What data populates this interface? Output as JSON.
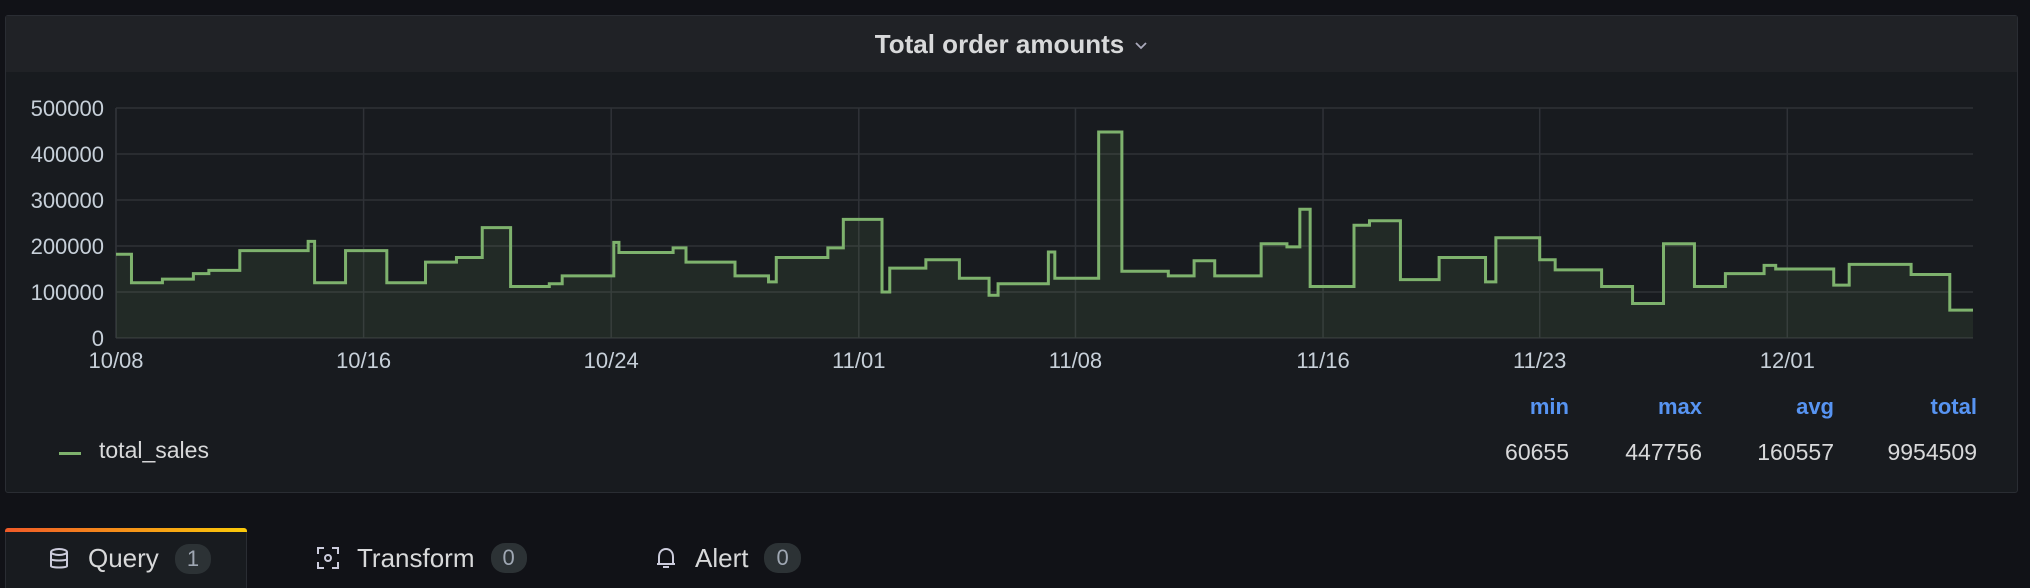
{
  "panel": {
    "title": "Total order amounts"
  },
  "chart_data": {
    "type": "area",
    "interpolation": "step-before",
    "series_color": "#7eb26d",
    "ylim": [
      0,
      500000
    ],
    "y_ticks": [
      "500000",
      "400000",
      "300000",
      "200000",
      "100000",
      "0"
    ],
    "x_ticks": [
      "10/08",
      "10/16",
      "10/24",
      "11/01",
      "11/08",
      "11/16",
      "11/23",
      "12/01"
    ],
    "x_range": [
      "2022-10-08",
      "2022-12-07"
    ],
    "grid": true,
    "series": [
      {
        "name": "total_sales",
        "points": [
          [
            "2022-10-08",
            182000
          ],
          [
            "2022-10-08T12",
            120000
          ],
          [
            "2022-10-09",
            120000
          ],
          [
            "2022-10-09T12",
            128000
          ],
          [
            "2022-10-10",
            128000
          ],
          [
            "2022-10-10T12",
            140000
          ],
          [
            "2022-10-11",
            147000
          ],
          [
            "2022-10-12",
            190000
          ],
          [
            "2022-10-13",
            190000
          ],
          [
            "2022-10-14",
            190000
          ],
          [
            "2022-10-14T05",
            210000
          ],
          [
            "2022-10-14T10",
            120000
          ],
          [
            "2022-10-15",
            120000
          ],
          [
            "2022-10-15T10",
            190000
          ],
          [
            "2022-10-16",
            190000
          ],
          [
            "2022-10-16T18",
            120000
          ],
          [
            "2022-10-17",
            120000
          ],
          [
            "2022-10-18",
            165000
          ],
          [
            "2022-10-19",
            175000
          ],
          [
            "2022-10-19T20",
            240000
          ],
          [
            "2022-10-20",
            240000
          ],
          [
            "2022-10-20T18",
            112000
          ],
          [
            "2022-10-21",
            112000
          ],
          [
            "2022-10-22",
            118000
          ],
          [
            "2022-10-22T10",
            135000
          ],
          [
            "2022-10-23",
            135000
          ],
          [
            "2022-10-24",
            135000
          ],
          [
            "2022-10-24T02",
            208000
          ],
          [
            "2022-10-24T06",
            186000
          ],
          [
            "2022-10-25",
            186000
          ],
          [
            "2022-10-26",
            196000
          ],
          [
            "2022-10-26T10",
            165000
          ],
          [
            "2022-10-27",
            165000
          ],
          [
            "2022-10-28",
            135000
          ],
          [
            "2022-10-29",
            135000
          ],
          [
            "2022-10-29T02",
            122000
          ],
          [
            "2022-10-29T08",
            175000
          ],
          [
            "2022-10-30",
            175000
          ],
          [
            "2022-10-31",
            196000
          ],
          [
            "2022-10-31T12",
            258000
          ],
          [
            "2022-11-01",
            258000
          ],
          [
            "2022-11-01T18",
            100000
          ],
          [
            "2022-11-02",
            152000
          ],
          [
            "2022-11-03",
            152000
          ],
          [
            "2022-11-03T04",
            170000
          ],
          [
            "2022-11-04",
            170000
          ],
          [
            "2022-11-04T06",
            130000
          ],
          [
            "2022-11-05",
            130000
          ],
          [
            "2022-11-05T05",
            93000
          ],
          [
            "2022-11-05T12",
            118000
          ],
          [
            "2022-11-06",
            118000
          ],
          [
            "2022-11-07",
            118000
          ],
          [
            "2022-11-07T03",
            187000
          ],
          [
            "2022-11-07T08",
            130000
          ],
          [
            "2022-11-08",
            130000
          ],
          [
            "2022-11-08T18",
            447756
          ],
          [
            "2022-11-09",
            447756
          ],
          [
            "2022-11-09T12",
            145000
          ],
          [
            "2022-11-10",
            145000
          ],
          [
            "2022-11-11",
            135000
          ],
          [
            "2022-11-11T20",
            168000
          ],
          [
            "2022-11-12",
            168000
          ],
          [
            "2022-11-12T12",
            135000
          ],
          [
            "2022-11-13",
            135000
          ],
          [
            "2022-11-14",
            205000
          ],
          [
            "2022-11-14T20",
            198000
          ],
          [
            "2022-11-15",
            198000
          ],
          [
            "2022-11-15T06",
            280000
          ],
          [
            "2022-11-15T14",
            112000
          ],
          [
            "2022-11-16",
            112000
          ],
          [
            "2022-11-17",
            245000
          ],
          [
            "2022-11-17T12",
            255000
          ],
          [
            "2022-11-18",
            255000
          ],
          [
            "2022-11-18T12",
            127000
          ],
          [
            "2022-11-19",
            127000
          ],
          [
            "2022-11-19T18",
            175000
          ],
          [
            "2022-11-20",
            175000
          ],
          [
            "2022-11-21",
            175000
          ],
          [
            "2022-11-21T06",
            122000
          ],
          [
            "2022-11-21T14",
            218000
          ],
          [
            "2022-11-22",
            218000
          ],
          [
            "2022-11-23",
            170000
          ],
          [
            "2022-11-23T12",
            148000
          ],
          [
            "2022-11-24",
            148000
          ],
          [
            "2022-11-25",
            112000
          ],
          [
            "2022-11-26",
            75000
          ],
          [
            "2022-11-26T12",
            75000
          ],
          [
            "2022-11-27",
            205000
          ],
          [
            "2022-11-28",
            112000
          ],
          [
            "2022-11-29",
            140000
          ],
          [
            "2022-11-30",
            140000
          ],
          [
            "2022-11-30T06",
            158000
          ],
          [
            "2022-11-30T15",
            150000
          ],
          [
            "2022-12-01",
            150000
          ],
          [
            "2022-12-02",
            150000
          ],
          [
            "2022-12-02T12",
            115000
          ],
          [
            "2022-12-03",
            160000
          ],
          [
            "2022-12-04",
            160000
          ],
          [
            "2022-12-05",
            138000
          ],
          [
            "2022-12-06",
            138000
          ],
          [
            "2022-12-06T06",
            60655
          ]
        ]
      }
    ]
  },
  "legend": {
    "series_name": "total_sales",
    "headers": {
      "min": "min",
      "max": "max",
      "avg": "avg",
      "total": "total"
    },
    "values": {
      "min": "60655",
      "max": "447756",
      "avg": "160557",
      "total": "9954509"
    }
  },
  "tabs": [
    {
      "label": "Query",
      "count": "1",
      "icon": "database-icon",
      "active": true
    },
    {
      "label": "Transform",
      "count": "0",
      "icon": "transform-icon",
      "active": false
    },
    {
      "label": "Alert",
      "count": "0",
      "icon": "bell-icon",
      "active": false
    }
  ]
}
